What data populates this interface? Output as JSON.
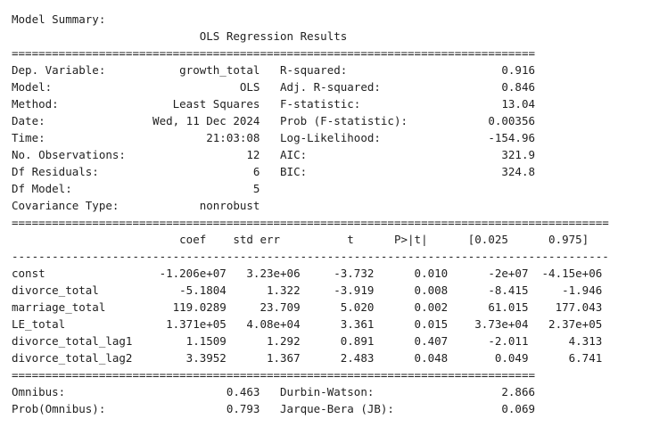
{
  "output_lines": [
    "Model Summary:",
    "                            OLS Regression Results                            ",
    "==============================================================================",
    "Dep. Variable:           growth_total   R-squared:                       0.916",
    "Model:                            OLS   Adj. R-squared:                  0.846",
    "Method:                 Least Squares   F-statistic:                     13.04",
    "Date:                Wed, 11 Dec 2024   Prob (F-statistic):            0.00356",
    "Time:                        21:03:08   Log-Likelihood:                -154.96",
    "No. Observations:                  12   AIC:                             321.9",
    "Df Residuals:                       6   BIC:                             324.8",
    "Df Model:                           5                                         ",
    "Covariance Type:            nonrobust                                         ",
    "=========================================================================================",
    "                         coef    std err          t      P>|t|      [0.025      0.975]",
    "-----------------------------------------------------------------------------------------",
    "const                 -1.206e+07   3.23e+06     -3.732      0.010      -2e+07  -4.15e+06",
    "divorce_total            -5.1804      1.322     -3.919      0.008      -8.415     -1.946",
    "marriage_total          119.0289     23.709      5.020      0.002      61.015    177.043",
    "LE_total               1.371e+05   4.08e+04      3.361      0.015    3.73e+04   2.37e+05",
    "divorce_total_lag1        1.1509      1.292      0.891      0.407      -2.011      4.313",
    "divorce_total_lag2        3.3952      1.367      2.483      0.048       0.049      6.741",
    "==============================================================================",
    "Omnibus:                        0.463   Durbin-Watson:                   2.866",
    "Prob(Omnibus):                  0.793   Jarque-Bera (JB):                0.069"
  ]
}
